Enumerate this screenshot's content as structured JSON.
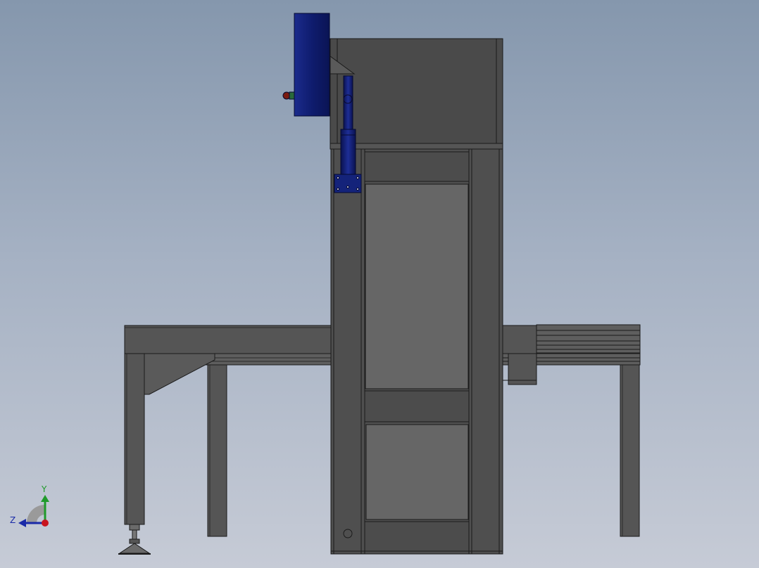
{
  "viewport": {
    "background_top": "#8597ad",
    "background_bottom": "#c6cbd6"
  },
  "model": {
    "frame_color": "#4f4f4f",
    "panel_color": "#666666",
    "edge_color": "#1a1a1a",
    "actuator_color": "#0f1c6e",
    "motor_color": "#14237a",
    "button_color": "#7a1a10"
  },
  "triad": {
    "y_label": "Y",
    "z_label": "Z",
    "y_color": "#1f9a2a",
    "z_color": "#1a2aa8",
    "x_color": "#c8141e"
  }
}
